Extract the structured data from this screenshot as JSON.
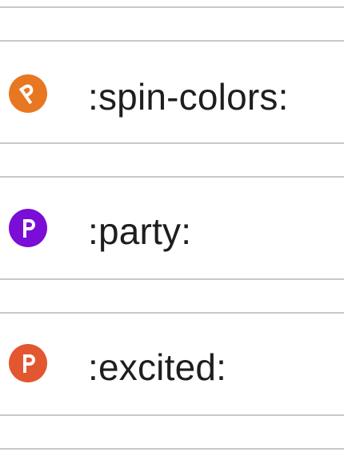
{
  "emoji_list": {
    "items": [
      {
        "label": ":spin-colors:",
        "icon": "spin-colors-icon",
        "color": "#e87722"
      },
      {
        "label": ":party:",
        "icon": "party-icon",
        "color": "#7a0dd6"
      },
      {
        "label": ":excited:",
        "icon": "excited-icon",
        "color": "#e2572f"
      }
    ]
  }
}
